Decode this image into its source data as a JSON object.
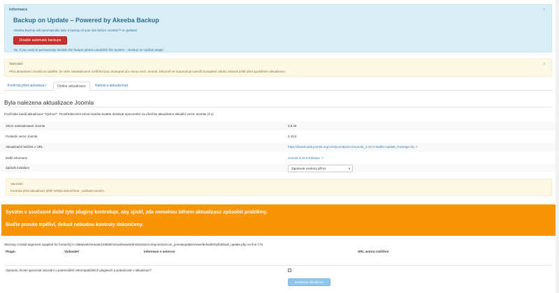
{
  "info_alert": {
    "label": "Informace",
    "title": "Backup on Update – Powered by Akeeba Backup",
    "description": "Akeeba Backup will automatically take a backup of your site before Joomla!™ is updated",
    "disable_button": "Disable automatic backups",
    "tip": "Tip: If you want to permanently disable this feature please unpublish the System – Backup on Update plugin.",
    "close": "×"
  },
  "warn_alert": {
    "label": "Varování",
    "text": "Před aktualizací Joomla se ujistěte, že váše nainstalované rozšíření jsou dostupné pro novou verzi Joomla. Důrazně se doporučuje vytvořit kompletní zálohu stránek ještě před spuštěním aktualizace.",
    "close": "×"
  },
  "tabs": [
    "Kontrola před aktualizací",
    "Online aktualizace",
    "Nahrát a aktualizovat"
  ],
  "heading": "Byla nalezena aktualizace Joomla",
  "intro": "Používáte kanál aktualizace \"Výchozí\". Prostřednictvím tohoto kanálu budete dostávat upozornění na všechny aktualizace aktuální verze Joomla! (3.x)",
  "rows": [
    {
      "k": "Verze nainstalované Joomla",
      "v": "3.9.28"
    },
    {
      "k": "Poslední verze Joomla",
      "v": "3.10.0"
    },
    {
      "k": "Aktualizační balíček z URL",
      "v": "https://downloads.joomla.org/cms/joomla310-0/Joomla_3.10.0-Stable-Update_Package.zip ↗"
    },
    {
      "k": "Další informace",
      "v": "Joomla 3.10.0 Release ↗"
    },
    {
      "k": "Způsob instalace",
      "v": "Zapisovat soubory přímo"
    }
  ],
  "select_caret": "▾",
  "warn2": {
    "label": "Varování",
    "text": "Kontrola před aktualizací ještě nebyla dokončena - počkejte prosím."
  },
  "orange": {
    "line1": "Systém v současné době tyto pluginy kontroluje, aby zjistil, zda nemohou během aktualizace způsobit problémy.",
    "line2": "Buďte prosím trpěliví, dokud nebudou kontroly dokončeny."
  },
  "php_warning": "Warning: Invalid argument supplied for foreach() in /data/web/virtuals/129696/virtual/www/administrator/components/com_joomlaupdate/views/default/tmpl/default_update.php on line 175",
  "table_headers": [
    "Plugin",
    "Vydavatel",
    "Informace o autorovi",
    "URL autora rozšíření"
  ],
  "question": "Opravdu chcete ignorovat varování o potenciálně nekompatibilních pluginech a pokračovat v aktualizaci?",
  "install_button": "Instalovat aktualizaci"
}
